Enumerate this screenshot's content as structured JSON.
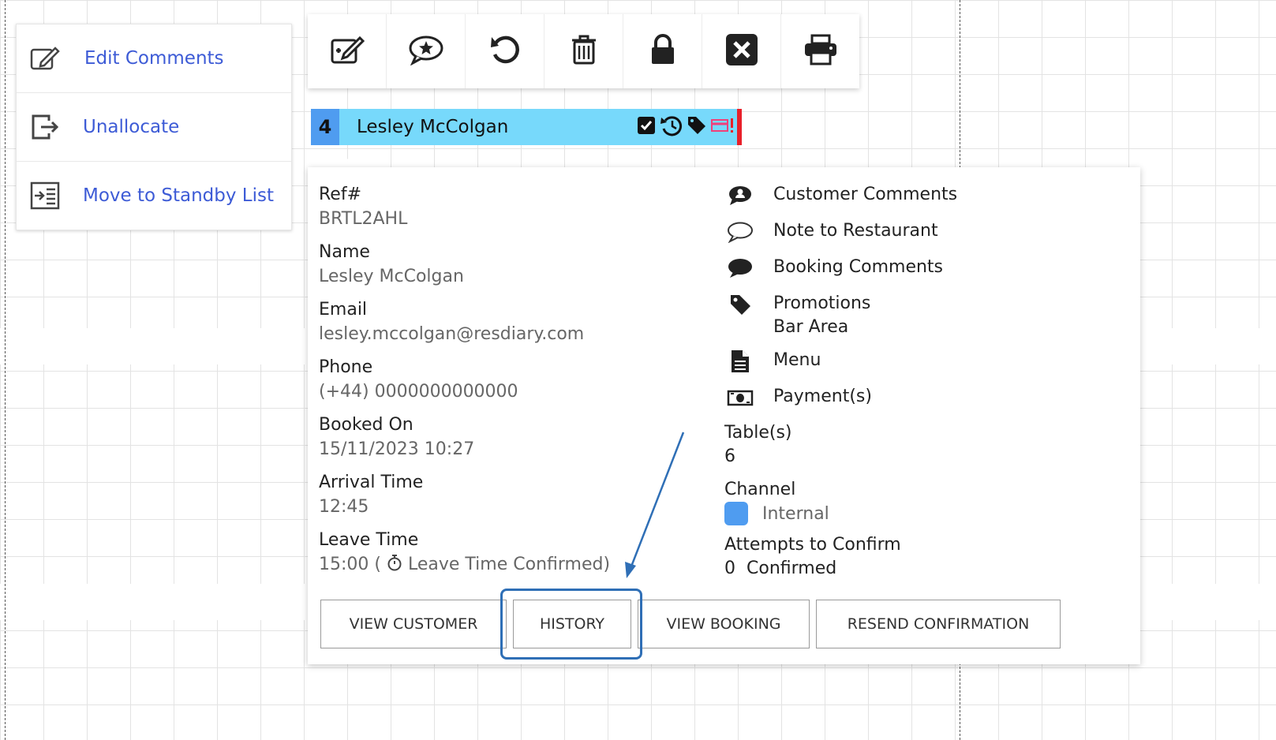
{
  "context_menu": {
    "items": [
      {
        "label": "Edit Comments",
        "icon": "edit-icon"
      },
      {
        "label": "Unallocate",
        "icon": "exit-icon"
      },
      {
        "label": "Move to Standby List",
        "icon": "standby-list-icon"
      }
    ]
  },
  "toolbar": {
    "buttons": [
      {
        "icon": "edit-note-icon"
      },
      {
        "icon": "star-comment-icon"
      },
      {
        "icon": "undo-icon"
      },
      {
        "icon": "trash-icon"
      },
      {
        "icon": "lock-icon"
      },
      {
        "icon": "close-icon"
      },
      {
        "icon": "print-icon"
      }
    ]
  },
  "booking_bar": {
    "number": "4",
    "name": "Lesley McColgan",
    "status_icons": [
      "checkbox-icon",
      "history-icon",
      "tag-icon",
      "alert-card-icon"
    ],
    "colors": {
      "bar": "#77d9fb",
      "number_bg": "#4f9cf0",
      "alert": "#e8202a"
    }
  },
  "details": {
    "left": [
      {
        "label": "Ref#",
        "value": "BRTL2AHL"
      },
      {
        "label": "Name",
        "value": "Lesley McColgan"
      },
      {
        "label": "Email",
        "value": "lesley.mccolgan@resdiary.com"
      },
      {
        "label": "Phone",
        "value": "(+44) 0000000000000"
      },
      {
        "label": "Booked On",
        "value": "15/11/2023 10:27"
      },
      {
        "label": "Arrival Time",
        "value": "12:45"
      }
    ],
    "leave": {
      "label": "Leave Time",
      "time": "15:00 (",
      "status": "Leave Time Confirmed)",
      "icon": "stopwatch-icon"
    },
    "right_items": [
      {
        "label": "Customer Comments",
        "icon": "customer-comment-icon"
      },
      {
        "label": "Note to Restaurant",
        "icon": "speech-bubble-outline-icon"
      },
      {
        "label": "Booking Comments",
        "icon": "speech-bubble-icon"
      },
      {
        "label": "Promotions",
        "sub": "Bar Area",
        "icon": "tag-icon"
      },
      {
        "label": "Menu",
        "icon": "document-icon"
      },
      {
        "label": "Payment(s)",
        "icon": "money-icon"
      }
    ],
    "tables": {
      "label": "Table(s)",
      "value": "6"
    },
    "channel": {
      "label": "Channel",
      "value": "Internal",
      "color": "#4f9cf0"
    },
    "attempts": {
      "label": "Attempts to Confirm",
      "count": "0",
      "status": "Confirmed"
    }
  },
  "actions": [
    {
      "label": "VIEW CUSTOMER"
    },
    {
      "label": "HISTORY"
    },
    {
      "label": "VIEW BOOKING"
    },
    {
      "label": "RESEND CONFIRMATION"
    }
  ],
  "annotation": {
    "color": "#2f6fb6"
  }
}
